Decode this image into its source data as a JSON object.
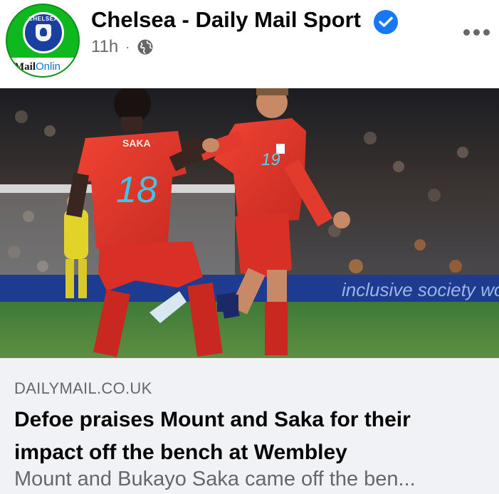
{
  "post": {
    "page_name": "Chelsea - Daily Mail Sport",
    "verified_icon": "verified-badge-icon",
    "time": "11h",
    "separator": "·",
    "audience_icon": "globe-icon",
    "more_icon": "more-options-icon",
    "avatar": {
      "crest_text": "CHELSEA",
      "brand_mail": "Mail",
      "brand_online": "Onlin"
    }
  },
  "photo": {
    "player_left_name": "SAKA",
    "player_left_number": "18",
    "player_right_number": "19",
    "board_text": "inclusive society wo"
  },
  "link_preview": {
    "domain": "DAILYMAIL.CO.UK",
    "headline": "Defoe praises Mount and Saka for their impact off the bench at Wembley",
    "description": "Mount and Bukayo Saka came off the ben..."
  },
  "colors": {
    "verified_blue": "#1877f2",
    "avatar_green": "#10b81f",
    "secondary_text": "#65676b",
    "preview_bg": "#f0f2f5",
    "kit_red": "#e0352b"
  }
}
